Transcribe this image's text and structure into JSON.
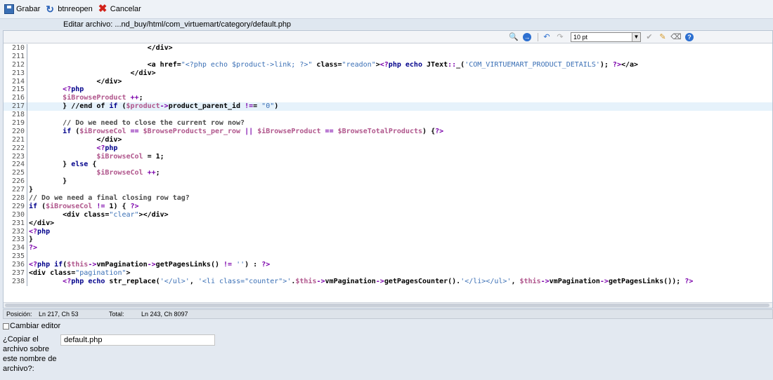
{
  "toolbar": {
    "save_label": "Grabar",
    "reopen_label": "btnreopen",
    "cancel_label": "Cancelar"
  },
  "title": "Editar archivo: ...nd_buy/html/com_virtuemart/category/default.php",
  "editor_toolbar": {
    "font_size": "10 pt",
    "icons": [
      "search-replace-icon",
      "goto-line-icon",
      "undo-icon",
      "redo-icon",
      "syntax-highlight-icon",
      "reset-highlight-icon",
      "word-wrap-icon",
      "help-icon"
    ]
  },
  "code_lines": [
    {
      "n": "210",
      "t": "                            </div>"
    },
    {
      "n": "211",
      "t": ""
    },
    {
      "n": "212",
      "t": "                            <a href=\"<?php echo $product->link; ?>\" class=\"readon\"><?php echo JText::_('COM_VIRTUEMART_PRODUCT_DETAILS'); ?></a>"
    },
    {
      "n": "213",
      "t": "                        </div>"
    },
    {
      "n": "214",
      "t": "                </div>"
    },
    {
      "n": "215",
      "t": "        <?php"
    },
    {
      "n": "216",
      "t": "        $iBrowseProduct ++;"
    },
    {
      "n": "217",
      "t": "        } //end of if ($product->product_parent_id !== \"0\")"
    },
    {
      "n": "218",
      "t": ""
    },
    {
      "n": "219",
      "t": "        // Do we need to close the current row now?"
    },
    {
      "n": "220",
      "t": "        if ($iBrowseCol == $BrowseProducts_per_row || $iBrowseProduct == $BrowseTotalProducts) {?>"
    },
    {
      "n": "221",
      "t": "                </div>"
    },
    {
      "n": "222",
      "t": "                <?php"
    },
    {
      "n": "223",
      "t": "                $iBrowseCol = 1;"
    },
    {
      "n": "224",
      "t": "        } else {"
    },
    {
      "n": "225",
      "t": "                $iBrowseCol ++;"
    },
    {
      "n": "226",
      "t": "        }"
    },
    {
      "n": "227",
      "t": "}"
    },
    {
      "n": "228",
      "t": "// Do we need a final closing row tag?"
    },
    {
      "n": "229",
      "t": "if ($iBrowseCol != 1) { ?>"
    },
    {
      "n": "230",
      "t": "        <div class=\"clear\"></div>"
    },
    {
      "n": "231",
      "t": "</div>"
    },
    {
      "n": "232",
      "t": "<?php"
    },
    {
      "n": "233",
      "t": "}"
    },
    {
      "n": "234",
      "t": "?>"
    },
    {
      "n": "235",
      "t": ""
    },
    {
      "n": "236",
      "t": "<?php if($this->vmPagination->getPagesLinks() != '') : ?>"
    },
    {
      "n": "237",
      "t": "<div class=\"pagination\">"
    },
    {
      "n": "238",
      "t": "        <?php echo str_replace('</ul>', '<li class=\"counter\">'.$this->vmPagination->getPagesCounter().'</li></ul>', $this->vmPagination->getPagesLinks()); ?>"
    }
  ],
  "active_line": "217",
  "status": {
    "position_label": "Posición:",
    "position_value": "Ln 217, Ch 53",
    "total_label": "Total:",
    "total_value": "Ln 243, Ch 8097"
  },
  "change_editor_label": "Cambiar editor",
  "copy_label": "¿Copiar el archivo sobre este nombre de archivo?:",
  "copy_value": "default.php"
}
